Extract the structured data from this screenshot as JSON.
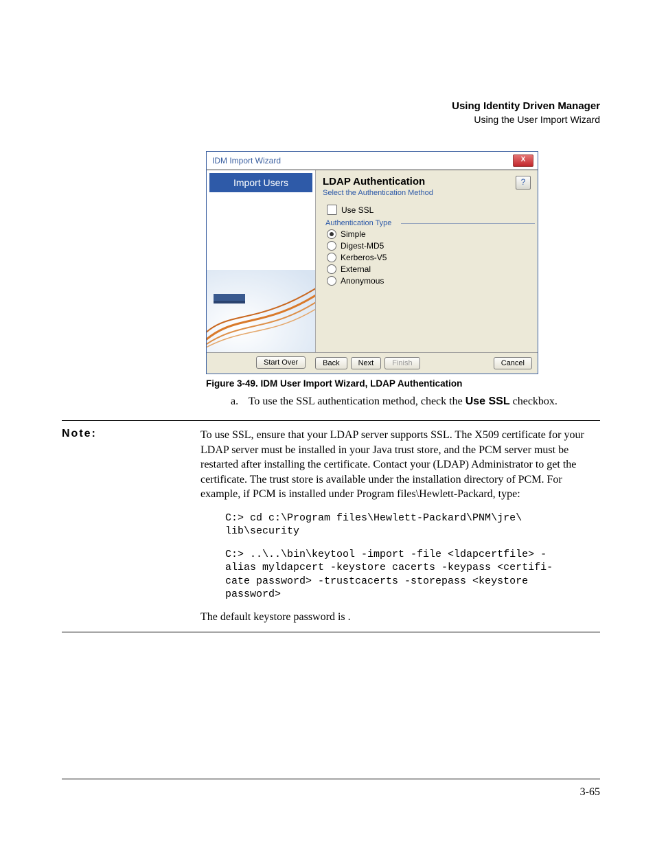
{
  "running_head": {
    "line1": "Using Identity Driven Manager",
    "line2": "Using the User Import Wizard"
  },
  "wizard": {
    "title": "IDM Import Wizard",
    "sidebar_tab": "Import Users",
    "heading": "LDAP Authentication",
    "subheading": "Select the Authentication Method",
    "use_ssl_label": "Use SSL",
    "auth_type_label": "Authentication Type",
    "options": {
      "simple": "Simple",
      "digest": "Digest-MD5",
      "kerberos": "Kerberos-V5",
      "external": "External",
      "anonymous": "Anonymous"
    },
    "selected_option": "simple",
    "buttons": {
      "start_over": "Start Over",
      "back": "Back",
      "next": "Next",
      "finish": "Finish",
      "cancel": "Cancel"
    }
  },
  "caption": "Figure 3-49. IDM User Import Wizard, LDAP Authentication",
  "step": {
    "marker": "a.",
    "text_pre": "To use the SSL authentication method, check the ",
    "bold": "Use SSL",
    "text_post": " checkbox."
  },
  "note": {
    "label": "Note:",
    "para": "To use SSL, ensure that your LDAP server supports SSL. The X509 certificate for your LDAP server must be installed in your Java trust store, and the PCM server must be restarted after installing the certificate. Contact your (LDAP) Administrator to get the certificate. The trust store is available under the installation directory of PCM. For example, if PCM is installed under Program files\\Hewlett-Packard, type:",
    "code1": "C:> cd c:\\Program files\\Hewlett-Packard\\PNM\\jre\\\nlib\\security",
    "code2": "C:> ..\\..\\bin\\keytool -import -file <ldapcertfile> -\nalias myldapcert -keystore cacerts -keypass <certifi-\ncate password> -trustcacerts -storepass <keystore\npassword>",
    "trailer": "The default keystore password is            ."
  },
  "page_number": "3-65"
}
